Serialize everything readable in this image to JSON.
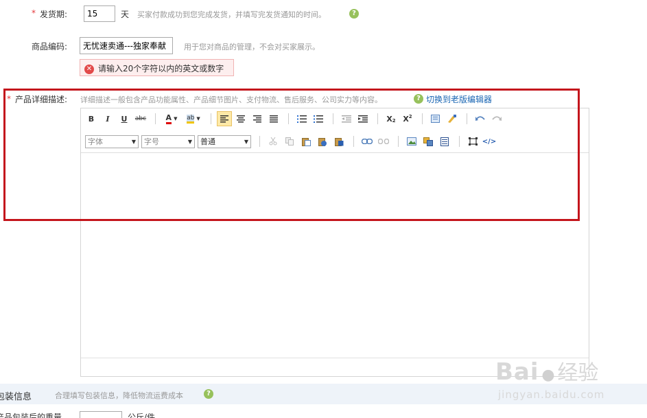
{
  "delivery": {
    "required_mark": "*",
    "label": "发货期:",
    "value": "15",
    "unit": "天",
    "hint": "买家付款成功到您完成发货，并填写完发货通知的时间。",
    "help_icon": "?"
  },
  "product_code": {
    "label": "商品编码:",
    "value": "无忧速卖通---独家奉献",
    "hint": "用于您对商品的管理，不会对买家展示。",
    "error": "请输入20个字符以内的英文或数字"
  },
  "description": {
    "required_mark": "*",
    "label": "产品详细描述:",
    "hint": "详细描述一般包含产品功能属性、产品细节图片、支付物流、售后服务、公司实力等内容。",
    "switch_link": "切换到老版编辑器"
  },
  "toolbar": {
    "bold": "B",
    "italic": "I",
    "underline": "U",
    "strike": "abc",
    "font_color": "A",
    "highlight": "ab",
    "font_family": "字体",
    "font_size": "字号",
    "format": "普通",
    "subscript": "X",
    "sub_mark": "2",
    "superscript": "X",
    "sup_mark": "2",
    "source": "</>"
  },
  "packaging": {
    "label": "包装信息",
    "hint": "合理填写包装信息，降低物流运费成本"
  },
  "bottom": {
    "label": "产品包装后的重量",
    "unit": "公斤/件"
  },
  "watermark": {
    "brand_a": "Bai",
    "brand_b": "经验",
    "url": "jingyan.baidu.com"
  }
}
